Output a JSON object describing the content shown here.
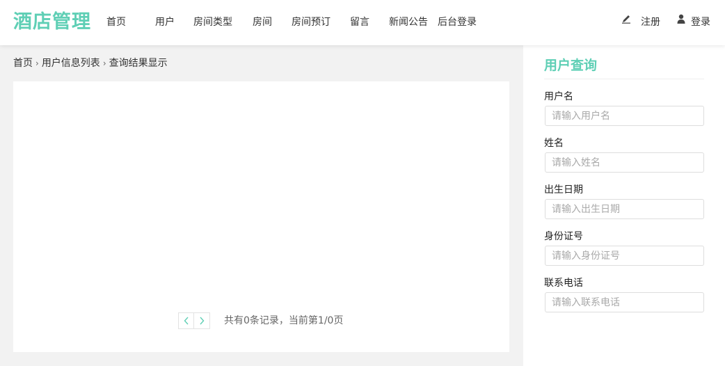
{
  "header": {
    "logo": "酒店管理",
    "nav": [
      "首页",
      "用户",
      "房间类型",
      "房间",
      "房间预订",
      "留言",
      "新闻公告",
      "后台登录"
    ],
    "register_label": "注册",
    "login_label": "登录"
  },
  "breadcrumb": [
    "首页",
    "用户信息列表",
    "查询结果显示"
  ],
  "pager": {
    "info": "共有0条记录，当前第1/0页"
  },
  "sidebar": {
    "title": "用户查询",
    "fields": [
      {
        "label": "用户名",
        "placeholder": "请输入用户名"
      },
      {
        "label": "姓名",
        "placeholder": "请输入姓名"
      },
      {
        "label": "出生日期",
        "placeholder": "请输入出生日期"
      },
      {
        "label": "身份证号",
        "placeholder": "请输入身份证号"
      },
      {
        "label": "联系电话",
        "placeholder": "请输入联系电话"
      }
    ]
  },
  "colors": {
    "accent": "#5fcfb5",
    "background": "#f2f2f2"
  },
  "icons": [
    "pencil-icon",
    "user-icon",
    "chevron-left-icon",
    "chevron-right-icon"
  ]
}
